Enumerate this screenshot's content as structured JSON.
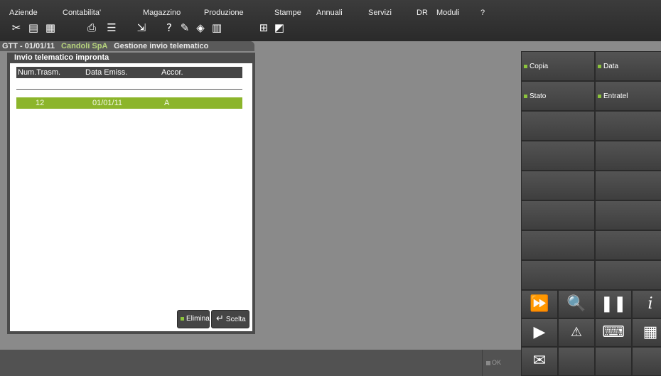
{
  "menu": [
    "Aziende",
    "Contabilita'",
    "Magazzino",
    "Produzione",
    "Stampe",
    "Annuali",
    "Servizi",
    "DR",
    "Moduli",
    "?"
  ],
  "titlebar": {
    "code": "GTT - 01/01/11",
    "company": "Candoli SpA",
    "module": "Gestione invio telematico"
  },
  "dialog": {
    "title": "Invio telematico impronta",
    "columns": [
      "Num.Trasm.",
      "Data Emiss.",
      "Accor."
    ],
    "rows": [
      [
        "12",
        "01/01/11",
        "A"
      ]
    ],
    "buttons": {
      "delete": "Elimina",
      "select": "Scelta"
    }
  },
  "function_keys": {
    "copy": "Copia",
    "date": "Data",
    "status": "Stato",
    "entratel": "Entratel"
  },
  "statusbar": {
    "ok": "OK"
  },
  "colors": {
    "accent_green": "#8cb52b",
    "led_green": "#8cc43c",
    "panel_dark": "#3a3a3a"
  }
}
